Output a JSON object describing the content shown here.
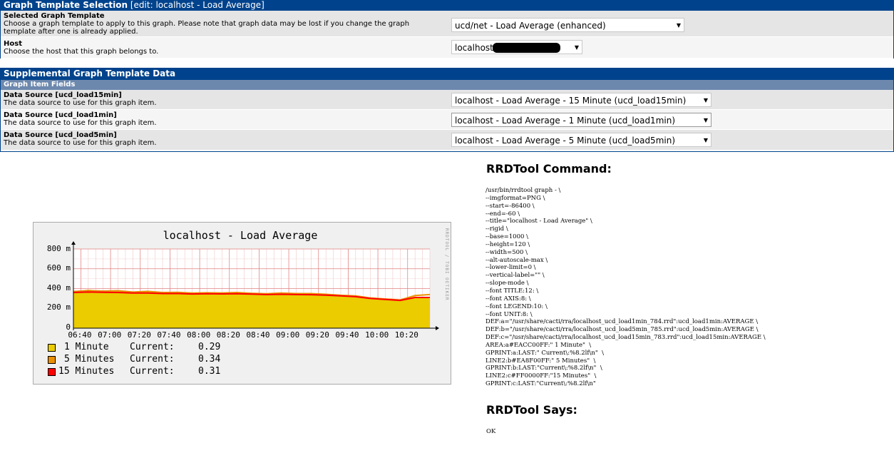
{
  "template_panel": {
    "title": "Graph Template Selection",
    "title_sub": " [edit: localhost - Load Average]",
    "rows": [
      {
        "label": "Selected Graph Template",
        "desc": "Choose a graph template to apply to this graph. Please note that graph data may be lost if you change the graph template after one is already applied.",
        "value": "ucd/net - Load Average (enhanced)"
      },
      {
        "label": "Host",
        "desc": "Choose the host that this graph belongs to.",
        "value": "localhost"
      }
    ]
  },
  "supplemental_panel": {
    "title": "Supplemental Graph Template Data",
    "section": "Graph Item Fields",
    "rows": [
      {
        "label": "Data Source [ucd_load15min]",
        "desc": "The data source to use for this graph item.",
        "value": "localhost - Load Average - 15 Minute (ucd_load15min)"
      },
      {
        "label": "Data Source [ucd_load1min]",
        "desc": "The data source to use for this graph item.",
        "value": "localhost - Load Average - 1 Minute (ucd_load1min)"
      },
      {
        "label": "Data Source [ucd_load5min]",
        "desc": "The data source to use for this graph item.",
        "value": "localhost - Load Average - 5 Minute (ucd_load5min)"
      }
    ]
  },
  "chart_data": {
    "type": "area",
    "title": "localhost - Load Average",
    "side_label": "RRDTOOL / TOBI OETIKER",
    "y_ticks": [
      "0",
      "200 m",
      "400 m",
      "600 m",
      "800 m"
    ],
    "ylim": [
      0,
      800
    ],
    "x_ticks": [
      "06:40",
      "07:00",
      "07:20",
      "07:40",
      "08:00",
      "08:20",
      "08:40",
      "09:00",
      "09:20",
      "09:40",
      "10:00",
      "10:20"
    ],
    "x_range": [
      "06:35",
      "10:35"
    ],
    "x": [
      "06:35",
      "06:45",
      "06:55",
      "07:05",
      "07:15",
      "07:25",
      "07:35",
      "07:45",
      "07:55",
      "08:05",
      "08:15",
      "08:25",
      "08:35",
      "08:45",
      "08:55",
      "09:05",
      "09:15",
      "09:25",
      "09:35",
      "09:45",
      "09:55",
      "10:05",
      "10:15",
      "10:25",
      "10:35"
    ],
    "series": [
      {
        "name": "1 Minute",
        "color": "#EACC00",
        "values": [
          360,
          390,
          370,
          380,
          360,
          375,
          355,
          365,
          350,
          360,
          355,
          365,
          350,
          345,
          360,
          350,
          355,
          340,
          330,
          325,
          300,
          290,
          280,
          320,
          300
        ],
        "current": "0.29"
      },
      {
        "name": "5 Minutes",
        "color": "#EA8F00",
        "values": [
          370,
          380,
          375,
          378,
          365,
          372,
          360,
          362,
          355,
          358,
          356,
          360,
          352,
          348,
          355,
          350,
          350,
          342,
          332,
          326,
          305,
          295,
          285,
          330,
          340
        ],
        "current": "0.34"
      },
      {
        "name": "15 Minutes",
        "color": "#FF0000",
        "values": [
          360,
          365,
          362,
          360,
          355,
          355,
          350,
          350,
          345,
          348,
          346,
          348,
          344,
          340,
          342,
          340,
          338,
          333,
          326,
          318,
          300,
          290,
          280,
          310,
          310
        ],
        "current": "0.31"
      }
    ],
    "grid": true,
    "legend_current_label": "Current:"
  },
  "rrd_command": {
    "title": "RRDTool Command:",
    "lines": [
      "/usr/bin/rrdtool graph - \\",
      "--imgformat=PNG \\",
      "--start=-86400 \\",
      "--end=-60 \\",
      "--title=\"localhost - Load Average\" \\",
      "--rigid \\",
      "--base=1000 \\",
      "--height=120 \\",
      "--width=500 \\",
      "--alt-autoscale-max \\",
      "--lower-limit=0 \\",
      "--vertical-label=\"\" \\",
      "--slope-mode \\",
      "--font TITLE:12: \\",
      "--font AXIS:8: \\",
      "--font LEGEND:10: \\",
      "--font UNIT:8: \\",
      "DEF:a=\"/usr/share/cacti/rra/localhost_ucd_load1min_784.rrd\":ucd_load1min:AVERAGE \\",
      "DEF:b=\"/usr/share/cacti/rra/localhost_ucd_load5min_785.rrd\":ucd_load5min:AVERAGE \\",
      "DEF:c=\"/usr/share/cacti/rra/localhost_ucd_load15min_783.rrd\":ucd_load15min:AVERAGE \\",
      "AREA:a#EACC00FF:\" 1 Minute\"  \\",
      "GPRINT:a:LAST:\" Current\\:%8.2lf\\n\"  \\",
      "LINE2:b#EA8F00FF:\" 5 Minutes\"  \\",
      "GPRINT:b:LAST:\"Current\\:%8.2lf\\n\"  \\",
      "LINE2:c#FF0000FF:\"15 Minutes\"  \\",
      "GPRINT:c:LAST:\"Current\\:%8.2lf\\n\""
    ]
  },
  "rrd_says": {
    "title": "RRDTool Says:",
    "text": "OK"
  }
}
